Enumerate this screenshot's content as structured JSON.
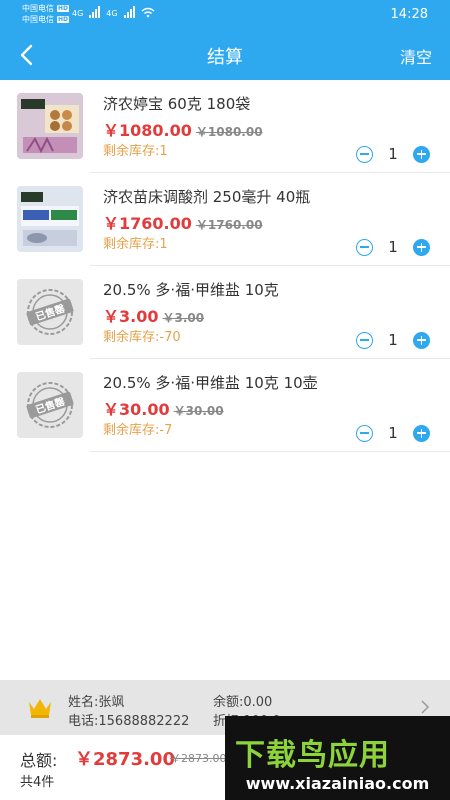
{
  "statusbar": {
    "carrier1": "中国电信",
    "carrier2": "中国电信",
    "hd": "HD",
    "net1": "4G",
    "net2": "4G",
    "time": "14:28"
  },
  "header": {
    "title": "结算",
    "clear_label": "清空"
  },
  "items": [
    {
      "name": "济农婷宝 60克  180袋",
      "price": "￥1080.00",
      "orig_price": "￥1080.00",
      "stock": "剩余库存:1",
      "qty": "1",
      "thumb": "product-photo"
    },
    {
      "name": "济农苗床调酸剂 250毫升  40瓶",
      "price": "￥1760.00",
      "orig_price": "￥1760.00",
      "stock": "剩余库存:1",
      "qty": "1",
      "thumb": "product-photo"
    },
    {
      "name": "20.5% 多·福·甲维盐 10克",
      "price": "￥3.00",
      "orig_price": "￥3.00",
      "stock": "剩余库存:-70",
      "qty": "1",
      "thumb": "sold-out-placeholder",
      "stamp": "已售罄"
    },
    {
      "name": "20.5% 多·福·甲维盐 10克  10壶",
      "price": "￥30.00",
      "orig_price": "￥30.00",
      "stock": "剩余库存:-7",
      "qty": "1",
      "thumb": "sold-out-placeholder",
      "stamp": "已售罄"
    }
  ],
  "member": {
    "name": "姓名:张飒",
    "phone": "电话:15688882222",
    "balance": "余额:0.00",
    "discount": "折扣:100.0"
  },
  "bottom": {
    "total_label": "总额:",
    "total": "￥2873.00",
    "total_orig": "￥2873.00",
    "count": "共4件"
  },
  "watermark": {
    "main": "下载鸟应用",
    "url": "www.xiazainiao.com"
  },
  "colors": {
    "accent": "#2ea8ee",
    "price": "#e33b3b",
    "stock": "#e6a24a"
  }
}
